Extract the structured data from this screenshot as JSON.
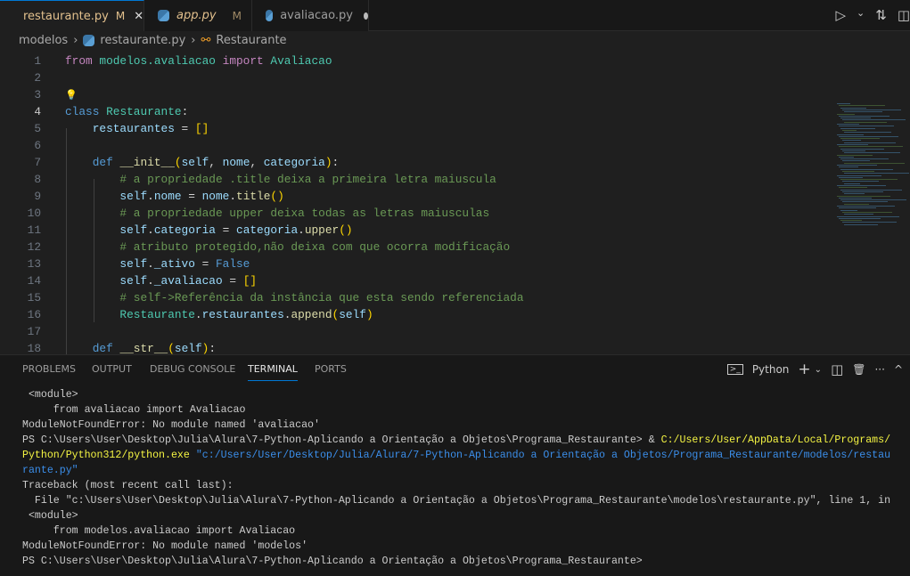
{
  "tabs": [
    {
      "label": "restaurante.py",
      "badge": "M",
      "active": true
    },
    {
      "label": "app.py",
      "badge": "M",
      "active": false
    },
    {
      "label": "avaliacao.py",
      "badge": "",
      "active": false
    }
  ],
  "actions": {
    "run": "▷",
    "run_menu": "⌄",
    "compare": "⇅",
    "split": "◫"
  },
  "breadcrumb": [
    "modelos",
    "restaurante.py",
    "Restaurante"
  ],
  "editor": {
    "current_line": 4,
    "lines": [
      [
        [
          "from",
          "kw2"
        ],
        [
          " modelos.avaliacao ",
          "cls"
        ],
        [
          "import",
          "kw2"
        ],
        [
          " Avaliacao",
          "cls"
        ]
      ],
      [],
      [
        [
          "💡",
          "bulb"
        ]
      ],
      [
        [
          "class",
          "kw"
        ],
        [
          " ",
          "pl"
        ],
        [
          "Restaurante",
          "cls"
        ],
        [
          ":",
          "pl"
        ]
      ],
      [
        [
          "    restaurantes",
          "var"
        ],
        [
          " = ",
          "pl"
        ],
        [
          "[]",
          "br"
        ]
      ],
      [],
      [
        [
          "    def",
          "kw"
        ],
        [
          " ",
          "pl"
        ],
        [
          "__init__",
          "fn"
        ],
        [
          "(",
          "br"
        ],
        [
          "self",
          "var"
        ],
        [
          ", ",
          "pl"
        ],
        [
          "nome",
          "var"
        ],
        [
          ", ",
          "pl"
        ],
        [
          "categoria",
          "var"
        ],
        [
          ")",
          "br"
        ],
        [
          ":",
          "pl"
        ]
      ],
      [
        [
          "        # a propriedade .title deixa a primeira letra maiuscula",
          "cm"
        ]
      ],
      [
        [
          "        self",
          "var"
        ],
        [
          ".",
          "pl"
        ],
        [
          "nome",
          "var"
        ],
        [
          " = ",
          "pl"
        ],
        [
          "nome",
          "var"
        ],
        [
          ".",
          "pl"
        ],
        [
          "title",
          "fn"
        ],
        [
          "()",
          "br"
        ]
      ],
      [
        [
          "        # a propriedade upper deixa todas as letras maiusculas",
          "cm"
        ]
      ],
      [
        [
          "        self",
          "var"
        ],
        [
          ".",
          "pl"
        ],
        [
          "categoria",
          "var"
        ],
        [
          " = ",
          "pl"
        ],
        [
          "categoria",
          "var"
        ],
        [
          ".",
          "pl"
        ],
        [
          "upper",
          "fn"
        ],
        [
          "()",
          "br"
        ]
      ],
      [
        [
          "        # atributo protegido,não deixa com que ocorra modificação",
          "cm"
        ]
      ],
      [
        [
          "        self",
          "var"
        ],
        [
          ".",
          "pl"
        ],
        [
          "_ativo",
          "var"
        ],
        [
          " = ",
          "pl"
        ],
        [
          "False",
          "bl"
        ]
      ],
      [
        [
          "        self",
          "var"
        ],
        [
          ".",
          "pl"
        ],
        [
          "_avaliacao",
          "var"
        ],
        [
          " = ",
          "pl"
        ],
        [
          "[]",
          "br"
        ]
      ],
      [
        [
          "        # self->Referência da instância que esta sendo referenciada",
          "cm"
        ]
      ],
      [
        [
          "        Restaurante",
          "cls"
        ],
        [
          ".",
          "pl"
        ],
        [
          "restaurantes",
          "var"
        ],
        [
          ".",
          "pl"
        ],
        [
          "append",
          "fn"
        ],
        [
          "(",
          "br"
        ],
        [
          "self",
          "var"
        ],
        [
          ")",
          "br"
        ]
      ],
      [],
      [
        [
          "    def",
          "kw"
        ],
        [
          " ",
          "pl"
        ],
        [
          "__str__",
          "fn"
        ],
        [
          "(",
          "br"
        ],
        [
          "self",
          "var"
        ],
        [
          ")",
          "br"
        ],
        [
          ":",
          "pl"
        ]
      ]
    ]
  },
  "panel": {
    "tabs": [
      "PROBLEMS",
      "OUTPUT",
      "DEBUG CONSOLE",
      "TERMINAL",
      "PORTS"
    ],
    "active_tab": "TERMINAL",
    "shell": "Python",
    "tools": {
      "new": "+",
      "menu": "⌄",
      "split": "◫",
      "kill": "🗑",
      "more": "···",
      "maximize": "^"
    }
  },
  "terminal": {
    "lines": [
      [
        [
          " <module>",
          ""
        ]
      ],
      [
        [
          "     from avaliacao import Avaliacao",
          ""
        ]
      ],
      [
        [
          "ModuleNotFoundError: No module named 'avaliacao'",
          ""
        ]
      ],
      [
        [
          "PS C:\\Users\\User\\Desktop\\Julia\\Alura\\7-Python-Aplicando a Orientação a Objetos\\Programa_Restaurante> & ",
          ""
        ],
        [
          "C:/Users/User/AppData/Local/Programs/",
          "y"
        ]
      ],
      [
        [
          "Python/Python312/python.exe",
          "y"
        ],
        [
          " \"c:/Users/User/Desktop/Julia/Alura/7-Python-Aplicando a Orientação a Objetos/Programa_Restaurante/modelos/restau",
          "c"
        ]
      ],
      [
        [
          "rante.py\"",
          "c"
        ]
      ],
      [
        [
          "Traceback (most recent call last):",
          ""
        ]
      ],
      [
        [
          "  File \"c:\\Users\\User\\Desktop\\Julia\\Alura\\7-Python-Aplicando a Orientação a Objetos\\Programa_Restaurante\\modelos\\restaurante.py\", line 1, in",
          ""
        ]
      ],
      [
        [
          " <module>",
          ""
        ]
      ],
      [
        [
          "     from modelos.avaliacao import Avaliacao",
          ""
        ]
      ],
      [
        [
          "ModuleNotFoundError: No module named 'modelos'",
          ""
        ]
      ],
      [
        [
          "PS C:\\Users\\User\\Desktop\\Julia\\Alura\\7-Python-Aplicando a Orientação a Objetos\\Programa_Restaurante>",
          ""
        ]
      ]
    ]
  }
}
